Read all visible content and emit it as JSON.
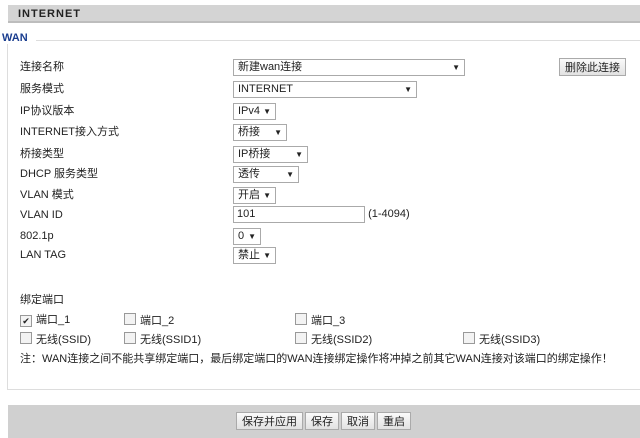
{
  "header": {
    "title": "INTERNET"
  },
  "section": {
    "legend": "WAN"
  },
  "form": {
    "conn_name": {
      "label": "连接名称",
      "value": "新建wan连接"
    },
    "delete_button": "删除此连接",
    "service_mode": {
      "label": "服务模式",
      "value": "INTERNET"
    },
    "ip_version": {
      "label": "IP协议版本",
      "value": "IPv4"
    },
    "access_mode": {
      "label": "INTERNET接入方式",
      "value": "桥接"
    },
    "bridge_type": {
      "label": "桥接类型",
      "value": "IP桥接"
    },
    "dhcp_type": {
      "label": "DHCP 服务类型",
      "value": "透传"
    },
    "vlan_mode": {
      "label": "VLAN 模式",
      "value": "开启"
    },
    "vlan_id": {
      "label": "VLAN ID",
      "value": "101",
      "hint": "(1-4094)"
    },
    "p8021": {
      "label": "802.1p",
      "value": "0"
    },
    "lan_tag": {
      "label": "LAN TAG",
      "value": "禁止"
    }
  },
  "bind": {
    "label": "绑定端口",
    "ports": [
      {
        "label": "端口_1",
        "checked": true
      },
      {
        "label": "端口_2",
        "checked": false
      },
      {
        "label": "端口_3",
        "checked": false
      },
      {
        "label": "无线(SSID)",
        "checked": false
      },
      {
        "label": "无线(SSID1)",
        "checked": false
      },
      {
        "label": "无线(SSID2)",
        "checked": false
      },
      {
        "label": "无线(SSID3)",
        "checked": false
      }
    ],
    "note": "注：WAN连接之间不能共享绑定端口，最后绑定端口的WAN连接绑定操作将冲掉之前其它WAN连接对该端口的绑定操作！"
  },
  "footer": {
    "save_apply": "保存并应用",
    "save": "保存",
    "cancel": "取消",
    "reboot": "重启"
  }
}
